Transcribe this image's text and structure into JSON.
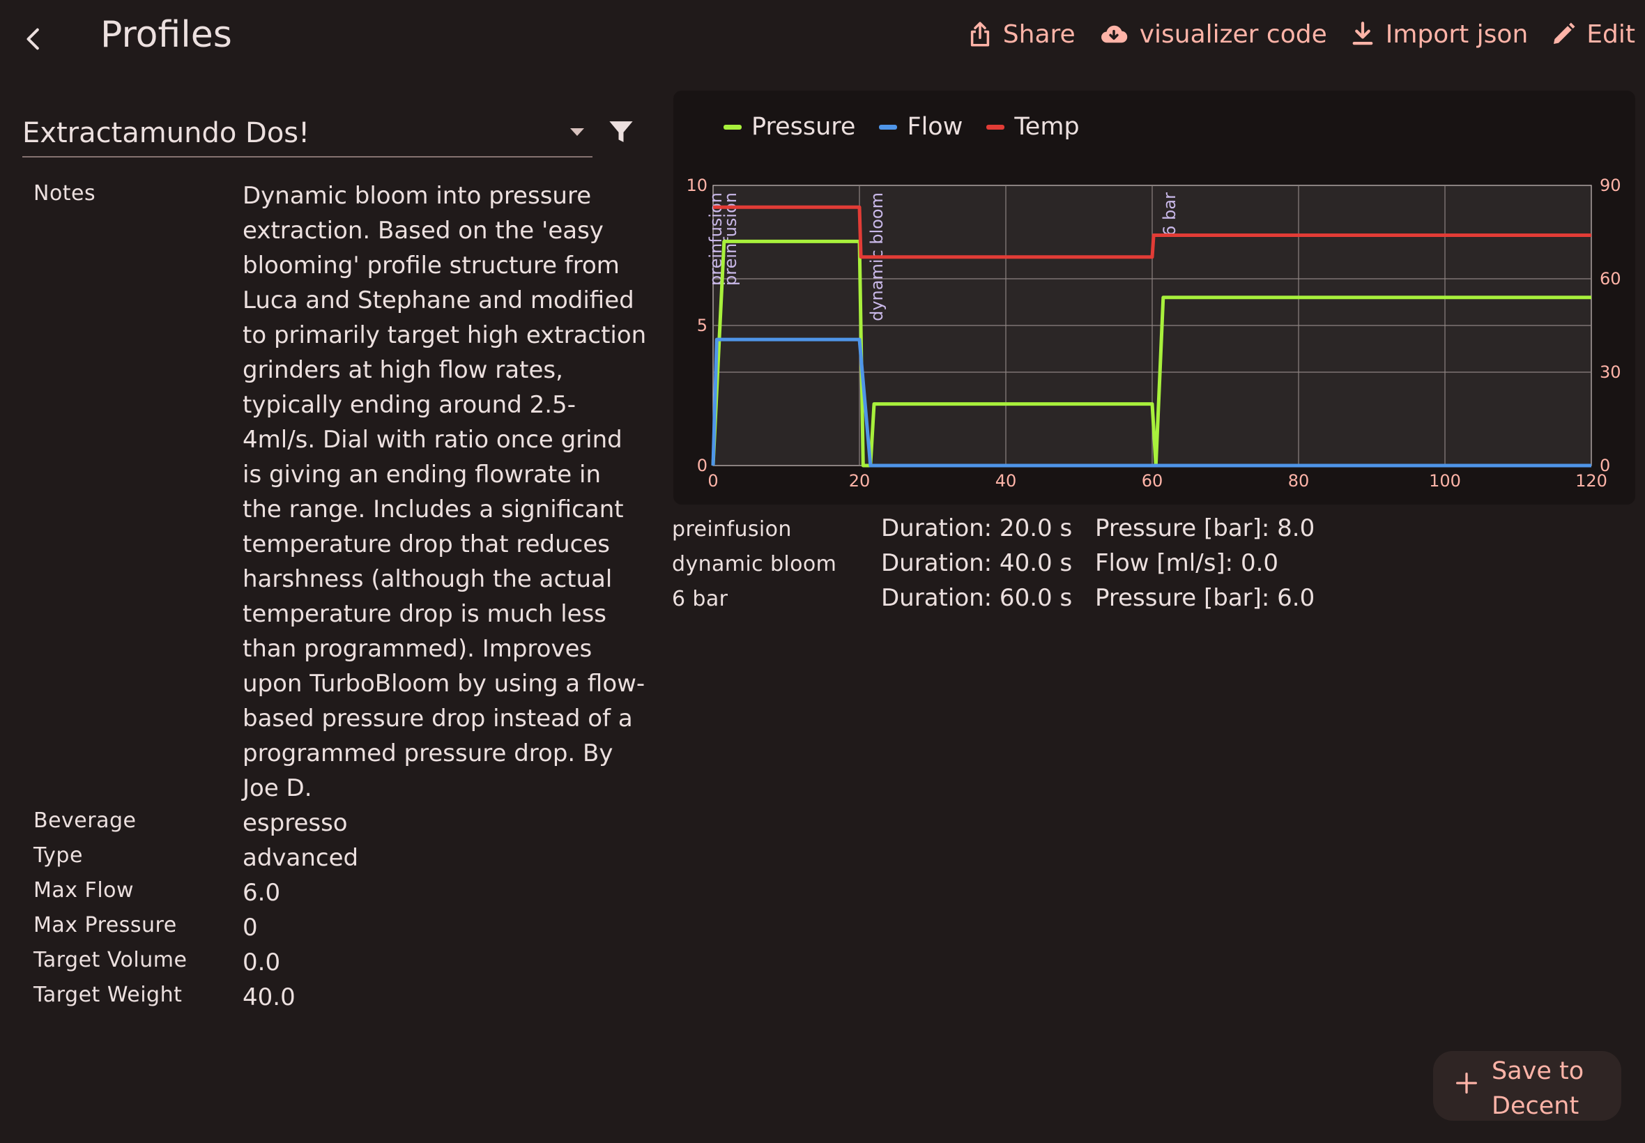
{
  "header": {
    "title": "Profiles",
    "actions": {
      "share": "Share",
      "visualizer": "visualizer code",
      "import": "Import json",
      "edit": "Edit"
    }
  },
  "profile_select": {
    "value": "Extractamundo Dos!"
  },
  "details": {
    "notes_label": "Notes",
    "notes_value": "Dynamic bloom into pressure extraction. Based on the 'easy blooming' profile structure from Luca and Stephane and modified to primarily target high extraction grinders at high flow rates, typically ending around 2.5-4ml/s. Dial with ratio once grind is giving an ending flowrate in the range. Includes a significant temperature drop that reduces harshness (although the actual temperature drop is much less than programmed). Improves upon TurboBloom by using a flow-based pressure drop instead of a programmed pressure drop. By Joe D.",
    "rows": [
      {
        "label": "Beverage",
        "value": "espresso"
      },
      {
        "label": "Type",
        "value": "advanced"
      },
      {
        "label": "Max Flow",
        "value": "6.0"
      },
      {
        "label": "Max Pressure",
        "value": "0"
      },
      {
        "label": "Target Volume",
        "value": "0.0"
      },
      {
        "label": "Target Weight",
        "value": "40.0"
      }
    ]
  },
  "chart_data": {
    "type": "line",
    "xlim": [
      0,
      120
    ],
    "ylim_left": [
      0,
      10
    ],
    "ylim_right": [
      0,
      90
    ],
    "x_ticks": [
      "0",
      "20",
      "40",
      "60",
      "80",
      "100",
      "120"
    ],
    "y_ticks_left": [
      "0",
      "5",
      "10"
    ],
    "y_ticks_right": [
      "0",
      "30",
      "60",
      "90"
    ],
    "grid": true,
    "legend_position": "top-left",
    "series": [
      {
        "name": "Pressure",
        "color": "#a8f03c",
        "axis": "left",
        "points": [
          [
            0,
            0
          ],
          [
            1.5,
            8
          ],
          [
            20,
            8
          ],
          [
            20.5,
            0
          ],
          [
            21.5,
            0
          ],
          [
            22,
            2.2
          ],
          [
            60,
            2.2
          ],
          [
            60.5,
            0
          ],
          [
            61.5,
            6
          ],
          [
            120,
            6
          ]
        ]
      },
      {
        "name": "Flow",
        "color": "#4f95e8",
        "axis": "left",
        "points": [
          [
            0,
            0
          ],
          [
            0.5,
            4.5
          ],
          [
            20,
            4.5
          ],
          [
            21.5,
            0
          ],
          [
            120,
            0
          ]
        ]
      },
      {
        "name": "Temp",
        "color": "#e23c36",
        "axis": "right",
        "points": [
          [
            0,
            83
          ],
          [
            20,
            83
          ],
          [
            20.2,
            67
          ],
          [
            60,
            67
          ],
          [
            60.2,
            74
          ],
          [
            120,
            74
          ]
        ]
      }
    ],
    "annotations": [
      {
        "label": "preinfusion",
        "x": 0
      },
      {
        "label": "preinfusion",
        "x": 2
      },
      {
        "label": "dynamic bloom",
        "x": 22
      },
      {
        "label": "6 bar",
        "x": 62
      }
    ]
  },
  "steps": [
    {
      "name": "preinfusion",
      "duration": "Duration: 20.0 s",
      "target": "Pressure [bar]: 8.0"
    },
    {
      "name": "dynamic bloom",
      "duration": "Duration: 40.0 s",
      "target": "Flow [ml/s]: 0.0"
    },
    {
      "name": "6 bar",
      "duration": "Duration: 60.0 s",
      "target": "Pressure [bar]: 6.0"
    }
  ],
  "save_button": {
    "label": "Save to Decent"
  },
  "colors": {
    "accent": "#ffb4a8",
    "background": "#201a1a",
    "card": "#181313"
  }
}
